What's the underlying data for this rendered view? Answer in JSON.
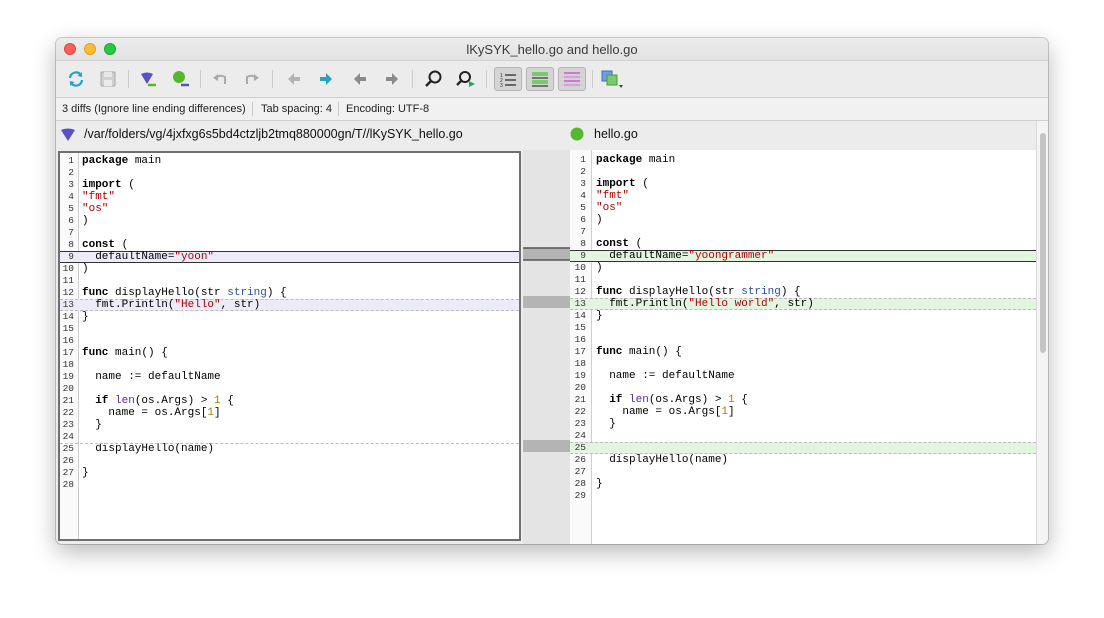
{
  "window": {
    "title": "lKySYK_hello.go and hello.go"
  },
  "toolbar": {
    "buttons": [
      "refresh-icon",
      "save-icon",
      "left-marker-icon",
      "right-marker-icon",
      "undo-icon",
      "redo-icon",
      "first-diff-icon",
      "next-diff-icon",
      "prev-diff-icon",
      "last-diff-icon",
      "find-icon",
      "find-next-icon",
      "line-numbers-icon",
      "changed-lines-icon",
      "whitespace-icon",
      "layout-menu-icon"
    ]
  },
  "status": {
    "diffs": "3 diffs (Ignore line ending differences)",
    "tab_spacing": "Tab spacing: 4",
    "encoding": "Encoding: UTF-8"
  },
  "files": {
    "left_path": "/var/folders/vg/4jxfxg6s5bd4ctzljb2tmq880000gn/T//lKySYK_hello.go",
    "right_path": "hello.go"
  },
  "colors": {
    "left_marker": "#5a50c8",
    "right_marker": "#55b82c",
    "left_change": "#ececf8",
    "right_change": "#e2f6df",
    "accent": "#2aa0c9"
  },
  "left_lines": [
    {
      "n": "1",
      "html": "<span class=\"kw\">package</span> main"
    },
    {
      "n": "2",
      "html": ""
    },
    {
      "n": "3",
      "html": "<span class=\"kw\">import</span> ("
    },
    {
      "n": "4",
      "html": "<span class=\"str\">\"fmt\"</span>"
    },
    {
      "n": "5",
      "html": "<span class=\"str\">\"os\"</span>"
    },
    {
      "n": "6",
      "html": ")"
    },
    {
      "n": "7",
      "html": ""
    },
    {
      "n": "8",
      "html": "<span class=\"kw\">const</span> ("
    },
    {
      "n": "9",
      "html": "  defaultName=<span class=\"str\">\"yoon\"</span>"
    },
    {
      "n": "10",
      "html": ")"
    },
    {
      "n": "11",
      "html": ""
    },
    {
      "n": "12",
      "html": "<span class=\"kw\">func</span> displayHello(str <span class=\"typ\">string</span>) {"
    },
    {
      "n": "13",
      "html": "  fmt.Println(<span class=\"str\">\"Hello\"</span>, str)"
    },
    {
      "n": "14",
      "html": "}"
    },
    {
      "n": "15",
      "html": ""
    },
    {
      "n": "16",
      "html": ""
    },
    {
      "n": "17",
      "html": "<span class=\"kw\">func</span> main() {"
    },
    {
      "n": "18",
      "html": ""
    },
    {
      "n": "19",
      "html": "  name := defaultName"
    },
    {
      "n": "20",
      "html": ""
    },
    {
      "n": "21",
      "html": "  <span class=\"kw\">if</span> <span class=\"fn\">len</span>(os.Args) &gt; <span class=\"num\">1</span> {"
    },
    {
      "n": "22",
      "html": "    name = os.Args[<span class=\"num\">1</span>]"
    },
    {
      "n": "23",
      "html": "  }"
    },
    {
      "n": "24",
      "html": ""
    },
    {
      "n": "25",
      "html": "  displayHello(name)"
    },
    {
      "n": "26",
      "html": ""
    },
    {
      "n": "27",
      "html": "}"
    },
    {
      "n": "28",
      "html": ""
    }
  ],
  "right_lines": [
    {
      "n": "1",
      "html": "<span class=\"kw\">package</span> main"
    },
    {
      "n": "2",
      "html": ""
    },
    {
      "n": "3",
      "html": "<span class=\"kw\">import</span> ("
    },
    {
      "n": "4",
      "html": "<span class=\"str\">\"fmt\"</span>"
    },
    {
      "n": "5",
      "html": "<span class=\"str\">\"os\"</span>"
    },
    {
      "n": "6",
      "html": ")"
    },
    {
      "n": "7",
      "html": ""
    },
    {
      "n": "8",
      "html": "<span class=\"kw\">const</span> ("
    },
    {
      "n": "9",
      "html": "  defaultName=<span class=\"str\">\"yoongrammer\"</span>"
    },
    {
      "n": "10",
      "html": ")"
    },
    {
      "n": "11",
      "html": ""
    },
    {
      "n": "12",
      "html": "<span class=\"kw\">func</span> displayHello(str <span class=\"typ\">string</span>) {"
    },
    {
      "n": "13",
      "html": "  fmt.Println(<span class=\"str\">\"Hello world\"</span>, str)"
    },
    {
      "n": "14",
      "html": "}"
    },
    {
      "n": "15",
      "html": ""
    },
    {
      "n": "16",
      "html": ""
    },
    {
      "n": "17",
      "html": "<span class=\"kw\">func</span> main() {"
    },
    {
      "n": "18",
      "html": ""
    },
    {
      "n": "19",
      "html": "  name := defaultName"
    },
    {
      "n": "20",
      "html": ""
    },
    {
      "n": "21",
      "html": "  <span class=\"kw\">if</span> <span class=\"fn\">len</span>(os.Args) &gt; <span class=\"num\">1</span> {"
    },
    {
      "n": "22",
      "html": "    name = os.Args[<span class=\"num\">1</span>]"
    },
    {
      "n": "23",
      "html": "  }"
    },
    {
      "n": "24",
      "html": ""
    },
    {
      "n": "25",
      "html": ""
    },
    {
      "n": "26",
      "html": "  displayHello(name)"
    },
    {
      "n": "27",
      "html": ""
    },
    {
      "n": "28",
      "html": "}"
    },
    {
      "n": "29",
      "html": ""
    }
  ],
  "left_changed": [
    9,
    13
  ],
  "right_changed": [
    9,
    13,
    25
  ]
}
